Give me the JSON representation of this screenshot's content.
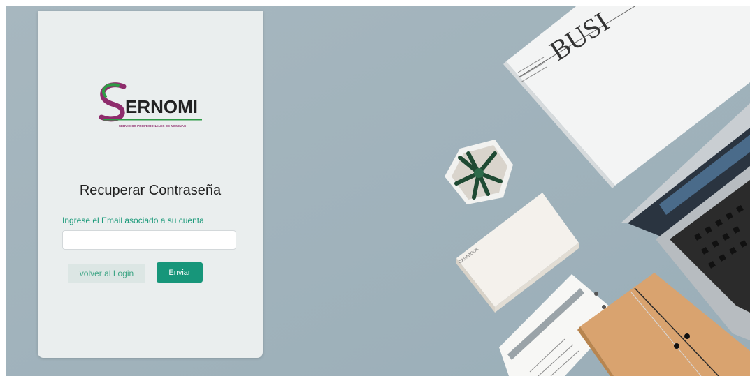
{
  "brand": {
    "name": "ERNOMI",
    "initial": "S",
    "tagline": "SERVICIOS PROFESIONALES DE NOMINAS"
  },
  "recovery": {
    "title": "Recuperar Contraseña",
    "email_label": "Ingrese el Email asociado a su cuenta",
    "email_value": "",
    "back_button": "volver al Login",
    "send_button": "Enviar"
  },
  "background": {
    "newspaper_headline": "BUSI",
    "box_brand": "CASABOOK"
  },
  "colors": {
    "accent": "#17967a",
    "label": "#1b9a7a",
    "backdrop": "#a8b8c0",
    "panel": "#eaeeee",
    "logo_purple": "#8e2c6c",
    "logo_green": "#2f9a46"
  }
}
